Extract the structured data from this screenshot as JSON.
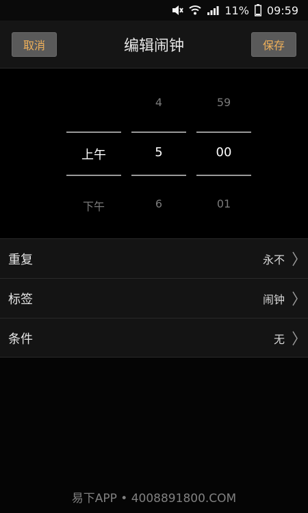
{
  "status_bar": {
    "battery_percent": "11%",
    "time": "09:59",
    "icons": [
      "mute-icon",
      "wifi-icon",
      "signal-icon",
      "battery-icon"
    ]
  },
  "header": {
    "cancel_label": "取消",
    "title": "编辑闹钟",
    "save_label": "保存",
    "button_text_color": "#f0b15a"
  },
  "picker": {
    "ampm": {
      "prev": "",
      "current": "上午",
      "next": "下午"
    },
    "hour": {
      "prev": "4",
      "current": "5",
      "next": "6"
    },
    "minute": {
      "prev": "59",
      "current": "00",
      "next": "01"
    }
  },
  "settings": [
    {
      "label": "重复",
      "value": "永不"
    },
    {
      "label": "标签",
      "value": "闹钟"
    },
    {
      "label": "条件",
      "value": "无"
    }
  ],
  "watermark": "易下APP • 4008891800.COM"
}
